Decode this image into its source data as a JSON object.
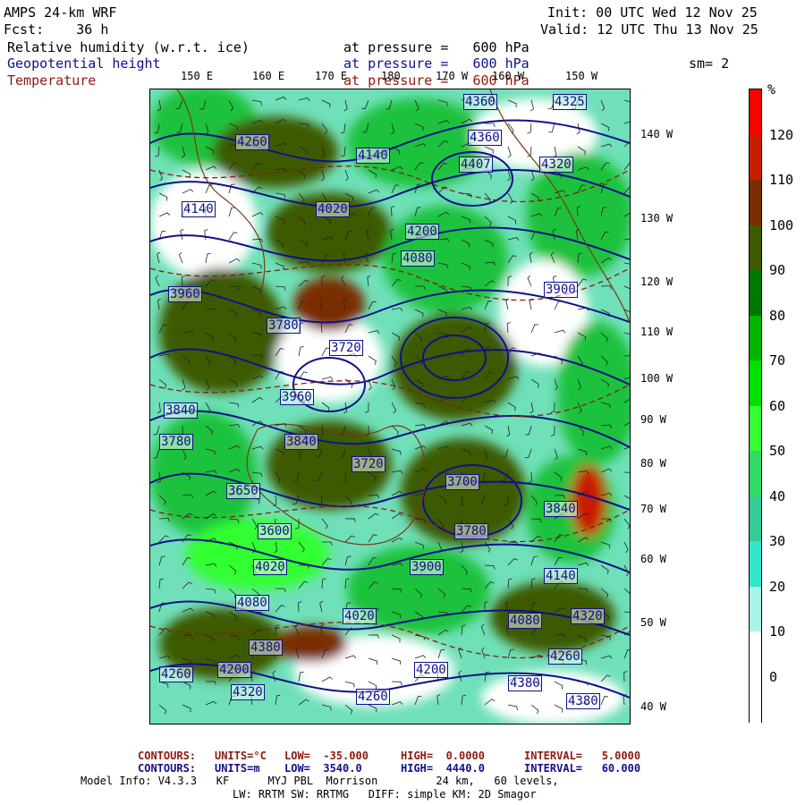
{
  "header": {
    "model": "AMPS 24-km WRF",
    "forecast": "Fcst:    36 h",
    "init": "Init: 00 UTC Wed 12 Nov 25",
    "valid": "Valid: 12 UTC Thu 13 Nov 25",
    "fields": [
      {
        "name": "Relative humidity (w.r.t. ice)",
        "level": "at pressure =   600 hPa",
        "color": "#000000"
      },
      {
        "name": "Geopotential height",
        "level": "at pressure =   600 hPa",
        "color": "#10108c"
      },
      {
        "name": "Temperature",
        "level": "at pressure =   600 hPa",
        "color": "#8c1a10"
      }
    ],
    "smoothing": "sm= 2"
  },
  "longitudes_top": [
    "150 E",
    "160 E",
    "170 E",
    "180",
    "170 W",
    "160 W",
    "150 W"
  ],
  "latitudes_right": [
    "140 W",
    "130 W",
    "120 W",
    "110 W",
    "100 W",
    "90 W",
    "80 W",
    "70 W",
    "60 W",
    "50 W",
    "40 W"
  ],
  "colorbar": {
    "unit": "%",
    "labels": [
      "120",
      "110",
      "100",
      "90",
      "80",
      "70",
      "60",
      "50",
      "40",
      "30",
      "20",
      "10",
      "0"
    ],
    "segments": [
      {
        "color": "#ff0000"
      },
      {
        "color": "#c81e00"
      },
      {
        "color": "#7a2e00"
      },
      {
        "color": "#3d5a00"
      },
      {
        "color": "#007800"
      },
      {
        "color": "#00b400"
      },
      {
        "color": "#00e000"
      },
      {
        "color": "#33ff33"
      },
      {
        "color": "#33d966"
      },
      {
        "color": "#33cc99"
      },
      {
        "color": "#33e6cc"
      },
      {
        "color": "#a8f5e6"
      },
      {
        "color": "#ffffff"
      },
      {
        "color": "#ffffff"
      }
    ]
  },
  "height_labels": [
    {
      "text": "4360"
    },
    {
      "text": "4325"
    },
    {
      "text": "4360"
    },
    {
      "text": "4320"
    },
    {
      "text": "4407"
    },
    {
      "text": "4260"
    },
    {
      "text": "4140"
    },
    {
      "text": "4200"
    },
    {
      "text": "4140"
    },
    {
      "text": "4020"
    },
    {
      "text": "4080"
    },
    {
      "text": "3960"
    },
    {
      "text": "3780"
    },
    {
      "text": "3720"
    },
    {
      "text": "3900"
    },
    {
      "text": "3840"
    },
    {
      "text": "3960"
    },
    {
      "text": "3780"
    },
    {
      "text": "3840"
    },
    {
      "text": "3720"
    },
    {
      "text": "3700"
    },
    {
      "text": "3650"
    },
    {
      "text": "3600"
    },
    {
      "text": "3780"
    },
    {
      "text": "3840"
    },
    {
      "text": "3900"
    },
    {
      "text": "4020"
    },
    {
      "text": "4140"
    },
    {
      "text": "4080"
    },
    {
      "text": "4020"
    },
    {
      "text": "4080"
    },
    {
      "text": "4200"
    },
    {
      "text": "4200"
    },
    {
      "text": "4260"
    },
    {
      "text": "4320"
    },
    {
      "text": "4260"
    },
    {
      "text": "4320"
    },
    {
      "text": "4380"
    },
    {
      "text": "4380"
    },
    {
      "text": "4260"
    },
    {
      "text": "4380"
    }
  ],
  "footer": {
    "line1": {
      "contours": "CONTOURS:",
      "units": "UNITS=°C",
      "low": "LOW=  -35.000",
      "high": "HIGH=  0.0000",
      "interval": "INTERVAL=   5.0000",
      "color": "#8c1a10"
    },
    "line2": {
      "contours": "CONTOURS:",
      "units": "UNITS=m",
      "low": "LOW=  3540.0",
      "high": "HIGH=  4440.0",
      "interval": "INTERVAL=   60.000",
      "color": "#10108c"
    },
    "line3": "Model Info: V4.3.3   KF      MYJ PBL  Morrison         24 km,   60 levels,",
    "line4": "LW: RRTM SW: RRTMG   DIFF: simple KM: 2D Smagor"
  }
}
